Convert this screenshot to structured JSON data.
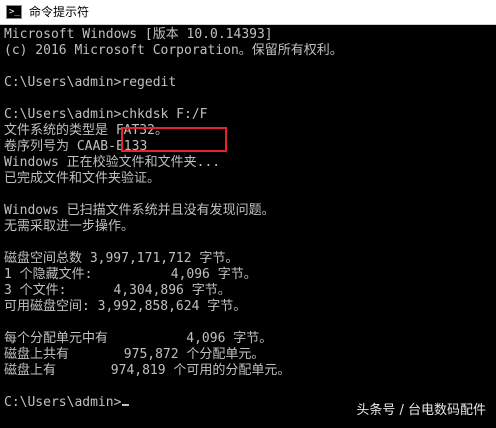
{
  "window": {
    "title": "命令提示符",
    "icon": "cmd-icon"
  },
  "console": {
    "lines": [
      "Microsoft Windows [版本 10.0.14393]",
      "(c) 2016 Microsoft Corporation。保留所有权利。",
      "",
      "C:\\Users\\admin>regedit",
      "",
      "C:\\Users\\admin>chkdsk F:/F",
      "文件系统的类型是 FAT32。",
      "卷序列号为 CAAB-E133",
      "Windows 正在校验文件和文件夹...",
      "已完成文件和文件夹验证。",
      "",
      "Windows 已扫描文件系统并且没有发现问题。",
      "无需采取进一步操作。",
      "",
      "磁盘空间总数 3,997,171,712 字节。",
      "1 个隐藏文件:          4,096 字节。",
      "3 个文件:      4,304,896 字节。",
      "可用磁盘空间: 3,992,858,624 字节。",
      "",
      "每个分配单元中有          4,096 字节。",
      "磁盘上共有       975,872 个分配单元。",
      "磁盘上有       974,819 个可用的分配单元。",
      "",
      "C:\\Users\\admin>"
    ]
  },
  "watermark": {
    "text": "头条号 / 台电数码配件"
  },
  "colors": {
    "console_bg": "#000000",
    "console_text": "#c0c0c0",
    "highlight_border": "#e8222e",
    "titlebar_bg": "#ffffff"
  }
}
